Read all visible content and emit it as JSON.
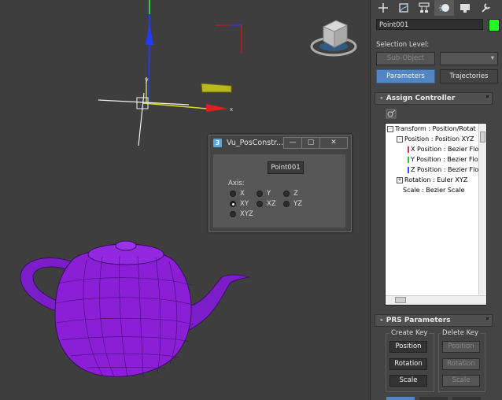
{
  "dialog": {
    "title": "Vu_PosConstr...",
    "app_icon": "3ds-max-icon",
    "minimize_glyph": "—",
    "restore_glyph": "▢",
    "close_glyph": "✕",
    "object_name": "Point001",
    "axis_label": "Axis:",
    "options": [
      "X",
      "Y",
      "Z",
      "XY",
      "XZ",
      "YZ",
      "XYZ"
    ],
    "selected": "XY"
  },
  "viewport": {
    "axis_labels": {
      "x": "x",
      "y": "y"
    },
    "teapot_color": "#8a1fd6"
  },
  "command_panel": {
    "tabs": [
      "create-icon",
      "modify-icon",
      "hierarchy-icon",
      "motion-icon",
      "display-icon",
      "utilities-icon"
    ],
    "object_name": "Point001",
    "object_color": "#22ff22",
    "selection_level_label": "Selection Level:",
    "sub_object_label": "Sub-Object",
    "parameters_label": "Parameters",
    "trajectories_label": "Trajectories",
    "assign_controller": {
      "title": "Assign Controller",
      "toggle": "-",
      "tree": [
        {
          "expander": "-",
          "text": "Transform : Position/Rotat"
        },
        {
          "expander": "-",
          "text": "Position : Position XYZ"
        },
        {
          "marker": "#e03030",
          "text": "X Position : Bezier Flo"
        },
        {
          "marker": "#30c030",
          "text": "Y Position : Bezier Flo"
        },
        {
          "marker": "#3050e0",
          "text": "Z Position : Bezier Flo"
        },
        {
          "expander": "+",
          "text": "Rotation : Euler XYZ"
        },
        {
          "text": "Scale : Bezier Scale"
        }
      ]
    },
    "prs": {
      "title": "PRS Parameters",
      "toggle": "-",
      "create_key_label": "Create Key",
      "delete_key_label": "Delete Key",
      "create_buttons": [
        "Position",
        "Rotation",
        "Scale"
      ],
      "delete_buttons": [
        "Position",
        "Rotation",
        "Scale"
      ]
    }
  }
}
